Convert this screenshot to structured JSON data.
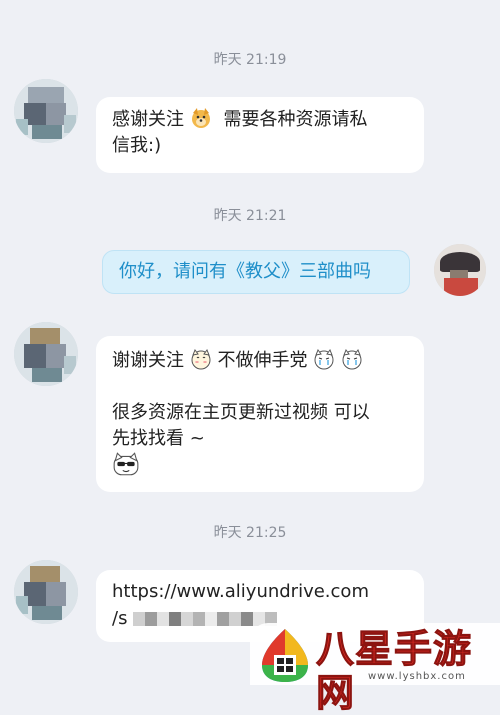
{
  "chat": {
    "timestamps": [
      "昨天 21:19",
      "昨天 21:21",
      "昨天 21:25"
    ],
    "messages": [
      {
        "id": "m1",
        "from": "other",
        "lines": [
          "感谢关注",
          "需要各种资源请私",
          "信我:)"
        ]
      },
      {
        "id": "m2",
        "from": "me",
        "text": "你好，请问有《教父》三部曲吗"
      },
      {
        "id": "m3",
        "from": "other",
        "lines": [
          "谢谢关注",
          "不做伸手党",
          "很多资源在主页更新过视频 可以",
          "先找找看 ~"
        ]
      },
      {
        "id": "m4",
        "from": "other",
        "lines": [
          "https://www.aliyundrive.com",
          "/s"
        ]
      }
    ],
    "emoji": {
      "doge": "doge-emoji",
      "cat": "cat-emoji",
      "cry": "crying-cat-emoji",
      "cool": "sunglasses-cat-emoji"
    }
  },
  "watermark": {
    "name": "八星手游网",
    "url": "www.lyshbx.com"
  },
  "colors": {
    "background": "#eef0f5",
    "my_bubble": "#d9f0fb",
    "my_text": "#1f8fc9",
    "watermark_red": "#e02a24"
  }
}
